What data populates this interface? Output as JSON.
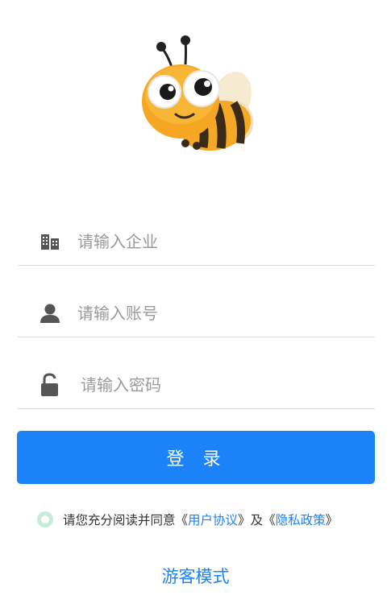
{
  "logo": {
    "icon": "bee-mascot-icon"
  },
  "form": {
    "company": {
      "placeholder": "请输入企业",
      "value": "",
      "icon": "building-icon"
    },
    "account": {
      "placeholder": "请输入账号",
      "value": "",
      "icon": "user-icon"
    },
    "password": {
      "placeholder": "请输入密码",
      "value": "",
      "icon": "lock-icon"
    }
  },
  "login_button": {
    "label": "登 录"
  },
  "agreement": {
    "prefix": "请您充分阅读并同意",
    "open1": "《",
    "user_agreement": "用户协议",
    "close1": "》",
    "and": "及",
    "open2": "《",
    "privacy_policy": "隐私政策",
    "close2": "》",
    "checked": false
  },
  "guest_mode": {
    "label": "游客模式"
  },
  "colors": {
    "accent": "#1b82f8",
    "divider": "#dcdcdc",
    "placeholder": "#9a9a9a",
    "icon": "#555555",
    "radio": "#c7ecd9"
  }
}
